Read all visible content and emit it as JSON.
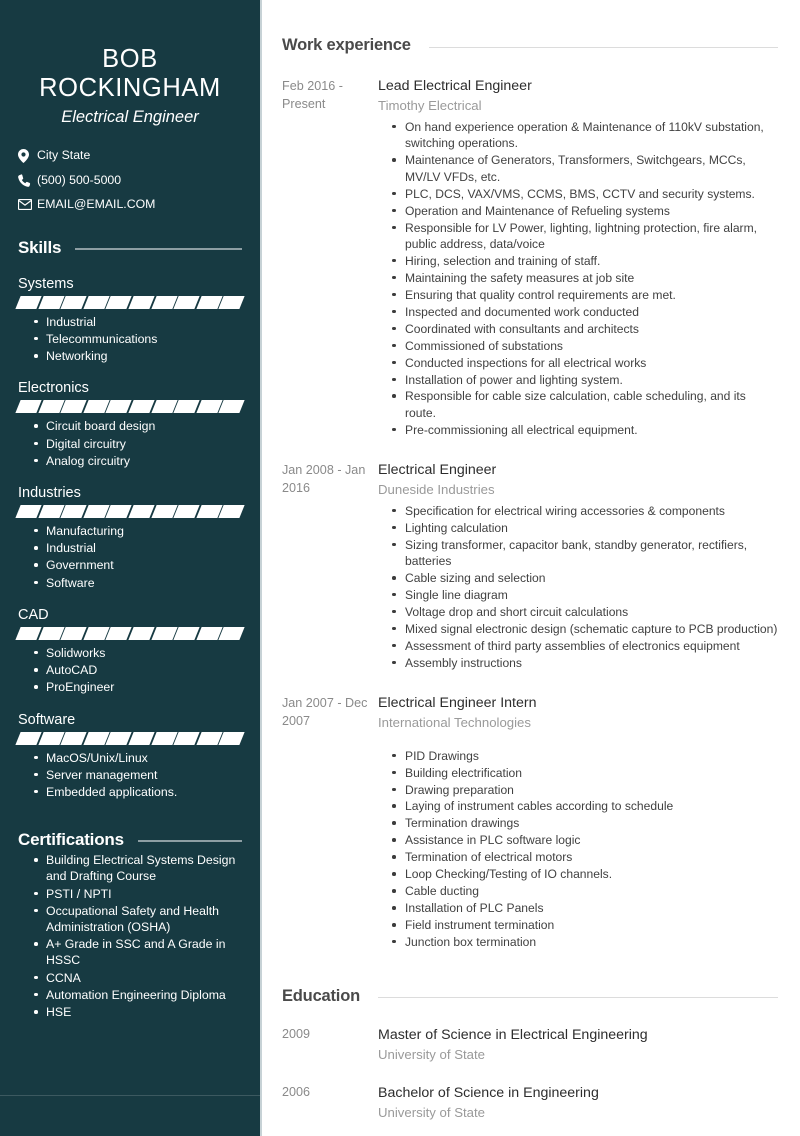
{
  "theme": {
    "sidebar_bg": "#173a42",
    "sidebar_text": "#ffffff",
    "main_bg": "#ffffff",
    "heading_color": "#4a4a4a",
    "muted_color": "#8a8a8a",
    "bar_color": "#ffffff"
  },
  "sidebar": {
    "name": "BOB ROCKINGHAM",
    "title": "Electrical Engineer",
    "contacts": [
      {
        "icon": "location-pin-icon",
        "value": "City State"
      },
      {
        "icon": "phone-icon",
        "value": "(500) 500-5000"
      },
      {
        "icon": "envelope-icon",
        "value": "EMAIL@EMAIL.COM"
      }
    ],
    "skills_heading": "Skills",
    "skill_groups": [
      {
        "label": "Systems",
        "segments": 10,
        "items": [
          "Industrial",
          "Telecommunications",
          "Networking"
        ]
      },
      {
        "label": "Electronics",
        "segments": 10,
        "items": [
          "Circuit board design",
          "Digital circuitry",
          "Analog circuitry"
        ]
      },
      {
        "label": "Industries",
        "segments": 10,
        "items": [
          "Manufacturing",
          "Industrial",
          "Government",
          "Software"
        ]
      },
      {
        "label": "CAD",
        "segments": 10,
        "items": [
          "Solidworks",
          "AutoCAD",
          "ProEngineer"
        ]
      },
      {
        "label": "Software",
        "segments": 10,
        "items": [
          "MacOS/Unix/Linux",
          "Server management",
          "Embedded applications."
        ]
      }
    ],
    "certifications_heading": "Certifications",
    "certifications": [
      "Building Electrical Systems Design and Drafting Course",
      "PSTI / NPTI",
      "Occupational Safety and Health Administration (OSHA)",
      "A+ Grade in SSC and A Grade in HSSC",
      "CCNA",
      "Automation Engineering Diploma",
      "HSE"
    ]
  },
  "main": {
    "work_heading": "Work experience",
    "jobs": [
      {
        "dates": "Feb 2016 - Present",
        "title": "Lead Electrical Engineer",
        "org": "Timothy Electrical",
        "bullets": [
          "On hand experience operation & Maintenance of 110kV substation, switching operations.",
          "Maintenance of Generators, Transformers, Switchgears, MCCs, MV/LV VFDs, etc.",
          "PLC, DCS, VAX/VMS, CCMS, BMS, CCTV and security systems.",
          "Operation and Maintenance of Refueling systems",
          "Responsible for LV Power, lighting, lightning protection, fire alarm, public address, data/voice",
          "Hiring, selection and training of staff.",
          "Maintaining the safety measures at job site",
          "Ensuring that quality control requirements are met.",
          "Inspected and documented work conducted",
          "Coordinated with consultants and architects",
          "Commissioned of substations",
          "Conducted inspections for all electrical works",
          "Installation of power and lighting system.",
          "Responsible for cable size calculation, cable scheduling, and its route.",
          "Pre-commissioning all electrical equipment."
        ]
      },
      {
        "dates": "Jan 2008 - Jan 2016",
        "title": "Electrical Engineer",
        "org": "Duneside Industries",
        "bullets": [
          "Specification for electrical wiring accessories & components",
          "Lighting calculation",
          "Sizing transformer, capacitor bank, standby generator, rectifiers, batteries",
          "Cable sizing and selection",
          "Single line diagram",
          "Voltage drop and short circuit calculations",
          "Mixed signal electronic design (schematic capture to PCB production)",
          "Assessment of third party assemblies of electronics equipment",
          "Assembly instructions"
        ]
      },
      {
        "dates": "Jan 2007 - Dec 2007",
        "title": "Electrical Engineer Intern",
        "org": "International Technologies",
        "bullets": [
          "PID Drawings",
          "Building electrification",
          "Drawing preparation",
          "Laying of instrument cables according to schedule",
          "Termination drawings",
          "Assistance in PLC software logic",
          "Termination of electrical motors",
          "Loop Checking/Testing of IO channels.",
          "Cable ducting",
          "Installation of  PLC Panels",
          "Field instrument termination",
          "Junction box termination"
        ]
      }
    ],
    "education_heading": "Education",
    "education": [
      {
        "year": "2009",
        "degree": "Master of Science in Electrical Engineering",
        "school": "University of State"
      },
      {
        "year": "2006",
        "degree": "Bachelor of Science in Engineering",
        "school": "University of State"
      }
    ]
  }
}
